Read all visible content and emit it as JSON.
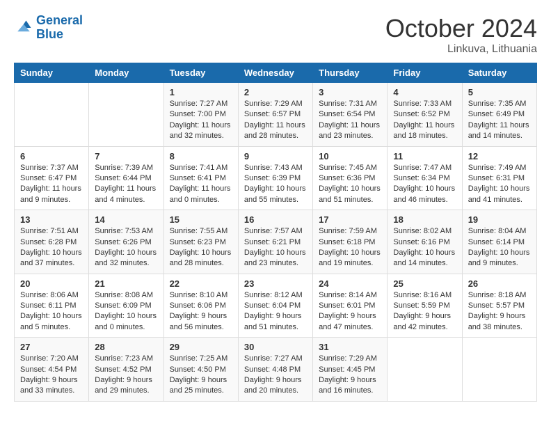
{
  "header": {
    "logo_line1": "General",
    "logo_line2": "Blue",
    "month": "October 2024",
    "location": "Linkuva, Lithuania"
  },
  "days_of_week": [
    "Sunday",
    "Monday",
    "Tuesday",
    "Wednesday",
    "Thursday",
    "Friday",
    "Saturday"
  ],
  "weeks": [
    [
      {
        "day": "",
        "info": ""
      },
      {
        "day": "",
        "info": ""
      },
      {
        "day": "1",
        "info": "Sunrise: 7:27 AM\nSunset: 7:00 PM\nDaylight: 11 hours and 32 minutes."
      },
      {
        "day": "2",
        "info": "Sunrise: 7:29 AM\nSunset: 6:57 PM\nDaylight: 11 hours and 28 minutes."
      },
      {
        "day": "3",
        "info": "Sunrise: 7:31 AM\nSunset: 6:54 PM\nDaylight: 11 hours and 23 minutes."
      },
      {
        "day": "4",
        "info": "Sunrise: 7:33 AM\nSunset: 6:52 PM\nDaylight: 11 hours and 18 minutes."
      },
      {
        "day": "5",
        "info": "Sunrise: 7:35 AM\nSunset: 6:49 PM\nDaylight: 11 hours and 14 minutes."
      }
    ],
    [
      {
        "day": "6",
        "info": "Sunrise: 7:37 AM\nSunset: 6:47 PM\nDaylight: 11 hours and 9 minutes."
      },
      {
        "day": "7",
        "info": "Sunrise: 7:39 AM\nSunset: 6:44 PM\nDaylight: 11 hours and 4 minutes."
      },
      {
        "day": "8",
        "info": "Sunrise: 7:41 AM\nSunset: 6:41 PM\nDaylight: 11 hours and 0 minutes."
      },
      {
        "day": "9",
        "info": "Sunrise: 7:43 AM\nSunset: 6:39 PM\nDaylight: 10 hours and 55 minutes."
      },
      {
        "day": "10",
        "info": "Sunrise: 7:45 AM\nSunset: 6:36 PM\nDaylight: 10 hours and 51 minutes."
      },
      {
        "day": "11",
        "info": "Sunrise: 7:47 AM\nSunset: 6:34 PM\nDaylight: 10 hours and 46 minutes."
      },
      {
        "day": "12",
        "info": "Sunrise: 7:49 AM\nSunset: 6:31 PM\nDaylight: 10 hours and 41 minutes."
      }
    ],
    [
      {
        "day": "13",
        "info": "Sunrise: 7:51 AM\nSunset: 6:28 PM\nDaylight: 10 hours and 37 minutes."
      },
      {
        "day": "14",
        "info": "Sunrise: 7:53 AM\nSunset: 6:26 PM\nDaylight: 10 hours and 32 minutes."
      },
      {
        "day": "15",
        "info": "Sunrise: 7:55 AM\nSunset: 6:23 PM\nDaylight: 10 hours and 28 minutes."
      },
      {
        "day": "16",
        "info": "Sunrise: 7:57 AM\nSunset: 6:21 PM\nDaylight: 10 hours and 23 minutes."
      },
      {
        "day": "17",
        "info": "Sunrise: 7:59 AM\nSunset: 6:18 PM\nDaylight: 10 hours and 19 minutes."
      },
      {
        "day": "18",
        "info": "Sunrise: 8:02 AM\nSunset: 6:16 PM\nDaylight: 10 hours and 14 minutes."
      },
      {
        "day": "19",
        "info": "Sunrise: 8:04 AM\nSunset: 6:14 PM\nDaylight: 10 hours and 9 minutes."
      }
    ],
    [
      {
        "day": "20",
        "info": "Sunrise: 8:06 AM\nSunset: 6:11 PM\nDaylight: 10 hours and 5 minutes."
      },
      {
        "day": "21",
        "info": "Sunrise: 8:08 AM\nSunset: 6:09 PM\nDaylight: 10 hours and 0 minutes."
      },
      {
        "day": "22",
        "info": "Sunrise: 8:10 AM\nSunset: 6:06 PM\nDaylight: 9 hours and 56 minutes."
      },
      {
        "day": "23",
        "info": "Sunrise: 8:12 AM\nSunset: 6:04 PM\nDaylight: 9 hours and 51 minutes."
      },
      {
        "day": "24",
        "info": "Sunrise: 8:14 AM\nSunset: 6:01 PM\nDaylight: 9 hours and 47 minutes."
      },
      {
        "day": "25",
        "info": "Sunrise: 8:16 AM\nSunset: 5:59 PM\nDaylight: 9 hours and 42 minutes."
      },
      {
        "day": "26",
        "info": "Sunrise: 8:18 AM\nSunset: 5:57 PM\nDaylight: 9 hours and 38 minutes."
      }
    ],
    [
      {
        "day": "27",
        "info": "Sunrise: 7:20 AM\nSunset: 4:54 PM\nDaylight: 9 hours and 33 minutes."
      },
      {
        "day": "28",
        "info": "Sunrise: 7:23 AM\nSunset: 4:52 PM\nDaylight: 9 hours and 29 minutes."
      },
      {
        "day": "29",
        "info": "Sunrise: 7:25 AM\nSunset: 4:50 PM\nDaylight: 9 hours and 25 minutes."
      },
      {
        "day": "30",
        "info": "Sunrise: 7:27 AM\nSunset: 4:48 PM\nDaylight: 9 hours and 20 minutes."
      },
      {
        "day": "31",
        "info": "Sunrise: 7:29 AM\nSunset: 4:45 PM\nDaylight: 9 hours and 16 minutes."
      },
      {
        "day": "",
        "info": ""
      },
      {
        "day": "",
        "info": ""
      }
    ]
  ]
}
